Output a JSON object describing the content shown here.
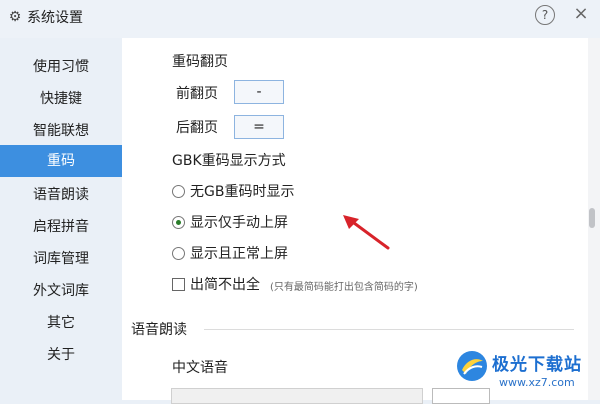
{
  "window": {
    "title": "系统设置",
    "help_symbol": "?",
    "close_symbol": "×"
  },
  "sidebar": {
    "items": [
      {
        "label": "使用习惯"
      },
      {
        "label": "快捷键"
      },
      {
        "label": "智能联想"
      },
      {
        "label": "重码",
        "active": true
      },
      {
        "label": "语音朗读"
      },
      {
        "label": "启程拼音"
      },
      {
        "label": "词库管理"
      },
      {
        "label": "外文词库"
      },
      {
        "label": "其它"
      },
      {
        "label": "关于"
      }
    ]
  },
  "page_turn": {
    "heading": "重码翻页",
    "prev_label": "前翻页",
    "prev_key": "-",
    "next_label": "后翻页",
    "next_key": "="
  },
  "gbk": {
    "heading": "GBK重码显示方式",
    "options": [
      {
        "label": "无GB重码时显示",
        "selected": false
      },
      {
        "label": "显示仅手动上屏",
        "selected": true
      },
      {
        "label": "显示且正常上屏",
        "selected": false
      }
    ]
  },
  "simple_code": {
    "label": "出简不出全",
    "checked": false,
    "hint": "(只有最简码能打出包含简码的字)"
  },
  "voice_section": {
    "heading": "语音朗读",
    "chinese_voice_label": "中文语音"
  },
  "watermark": {
    "brand": "极光下载站",
    "url": "www.xz7.com"
  },
  "colors": {
    "accent": "#3d8fe0",
    "arrow": "#d8232a",
    "radio_dot": "#2a7d2a"
  }
}
